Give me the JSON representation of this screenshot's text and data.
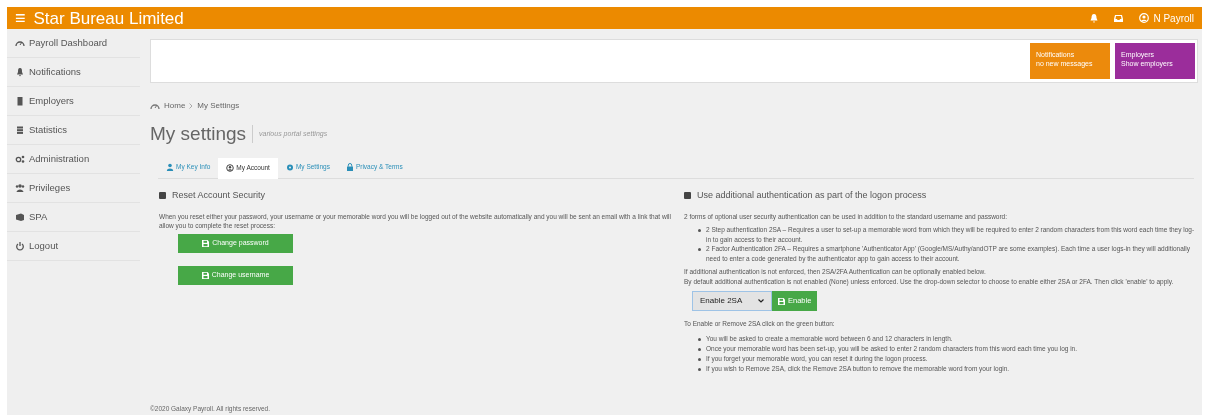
{
  "header": {
    "menu_icon": "≡",
    "title": "Star Bureau Limited",
    "user": "N Payroll"
  },
  "sidebar": {
    "items": [
      {
        "label": "Payroll Dashboard",
        "selected": false
      },
      {
        "label": "Notifications",
        "selected": false
      },
      {
        "label": "Employers",
        "selected": false
      },
      {
        "label": "Statistics",
        "selected": false
      },
      {
        "label": "Administration",
        "selected": false
      },
      {
        "label": "Privileges",
        "selected": false
      },
      {
        "label": "SPA",
        "selected": false
      },
      {
        "label": "Logout",
        "selected": false
      }
    ]
  },
  "tiles": [
    {
      "title": "Notifications",
      "subtitle": "no new messages",
      "color": "#ec8a0c"
    },
    {
      "title": "Employers",
      "subtitle": "Show employers",
      "color": "#9b2d9b"
    }
  ],
  "breadcrumb": [
    "Home",
    "My Settings"
  ],
  "page": {
    "title": "My settings",
    "subtitle": "various portal settings"
  },
  "tabs": [
    {
      "label": "My Key Info",
      "selected": false
    },
    {
      "label": "My Account",
      "selected": true
    },
    {
      "label": "My Settings",
      "selected": false
    },
    {
      "label": "Privacy & Terms",
      "selected": false
    }
  ],
  "reset": {
    "heading": "Reset Account Security",
    "text": "When you reset either your password, your username or your memorable word you will be logged out of the website automatically and you will be sent an email with a link that will allow you to complete the reset process:",
    "buttons": [
      "Change password",
      "Change username"
    ]
  },
  "auth": {
    "heading": "Use additional authentication as part of the logon process",
    "intro": "2 forms of optional user security authentication can be used in addition to the standard username and password:",
    "options": [
      "2 Step authentication 2SA – Requires a user to set-up a memorable word from which they will be required to enter 2 random characters from this word each time they log-in to gain access to their account.",
      "2 Factor Authentication 2FA – Requires a smartphone 'Authenticator App' (Google/MS/Authy/andOTP are some examples). Each time a user logs-in they will additionally need to enter a code generated by the authenticator app to gain access to their account."
    ],
    "note1": "If additional authentication is not enforced, then 2SA/2FA Authentication can be optionally enabled below.",
    "note2": "By default additional authentication is not enabled (None) unless enforced. Use the drop-down selector to choose to enable either 2SA or 2FA. Then click 'enable' to apply.",
    "select_value": "Enable 2SA",
    "enable_button": "Enable",
    "how_to": "To Enable or Remove 2SA click on the green button:",
    "steps": [
      "You will be asked to create a memorable word between 6 and 12 characters in length.",
      "Once your memorable word has been set-up, you will be asked to enter 2 random characters from this word each time you log in.",
      "If you forget your memorable word, you can reset it during the logon process.",
      "If you wish to Remove 2SA, click the Remove 2SA button to remove the memorable word from your login."
    ]
  },
  "footer": "©2020 Galaxy Payroll. All rights reserved."
}
